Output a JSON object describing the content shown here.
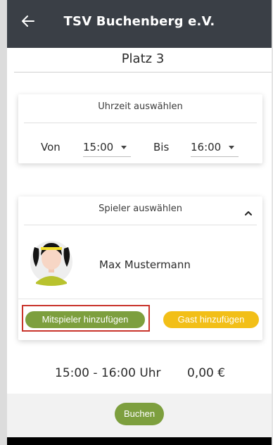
{
  "header": {
    "title": "TSV Buchenberg e.V.",
    "back_icon": "arrow-left-icon"
  },
  "court": {
    "name": "Platz 3"
  },
  "time_card": {
    "heading": "Uhrzeit auswählen",
    "from_label": "Von",
    "from_value": "15:00",
    "to_label": "Bis",
    "to_value": "16:00"
  },
  "player_card": {
    "heading": "Spieler auswählen",
    "collapse_icon": "chevron-up-icon",
    "player_name": "Max Mustermann",
    "add_teammate_label": "Mitspieler hinzufügen",
    "add_guest_label": "Gast hinzufügen"
  },
  "summary": {
    "time_range": "15:00 - 16:00 Uhr",
    "price": "0,00 €"
  },
  "footer": {
    "book_label": "Buchen"
  },
  "colors": {
    "topbar": "#3a3f46",
    "green": "#7d9f3e",
    "yellow": "#f2bf18",
    "highlight": "#c9342b"
  }
}
